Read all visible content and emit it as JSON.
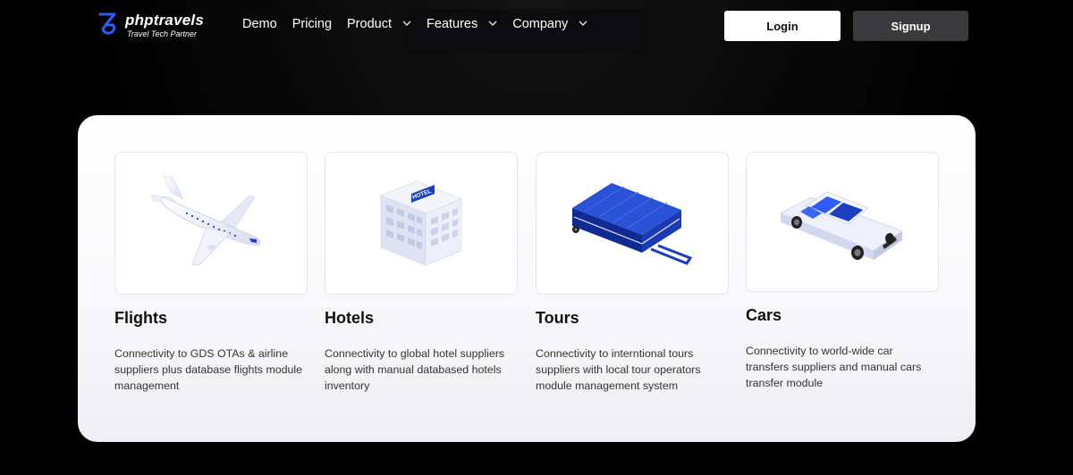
{
  "brand": {
    "name": "phptravels",
    "tagline": "Travel Tech Partner",
    "logo_icon": "phptravels-logo-icon",
    "accent": "#2f5cff"
  },
  "nav": {
    "items": [
      {
        "label": "Demo",
        "has_dropdown": false
      },
      {
        "label": "Pricing",
        "has_dropdown": false
      },
      {
        "label": "Product",
        "has_dropdown": true
      },
      {
        "label": "Features",
        "has_dropdown": true
      },
      {
        "label": "Company",
        "has_dropdown": true
      }
    ],
    "chevron_icon": "chevron-down-icon"
  },
  "auth": {
    "login_label": "Login",
    "signup_label": "Signup"
  },
  "modules": [
    {
      "title": "Flights",
      "description": "Connectivity to GDS OTAs & airline suppliers plus database flights module management",
      "icon": "airplane-icon"
    },
    {
      "title": "Hotels",
      "description": "Connectivity to global hotel suppliers along with manual databased hotels inventory",
      "icon": "hotel-building-icon",
      "icon_text": "HOTEL"
    },
    {
      "title": "Tours",
      "description": "Connectivity to interntional tours suppliers with local tour operators module management system",
      "icon": "suitcase-icon"
    },
    {
      "title": "Cars",
      "description": "Connectivity to world-wide car transfers suppliers and manual cars transfer module",
      "icon": "car-icon"
    }
  ],
  "colors": {
    "background": "#000000",
    "panel": "#ffffff",
    "signup_button": "#3a3a3c",
    "icon_blue": "#1b3fbf"
  }
}
